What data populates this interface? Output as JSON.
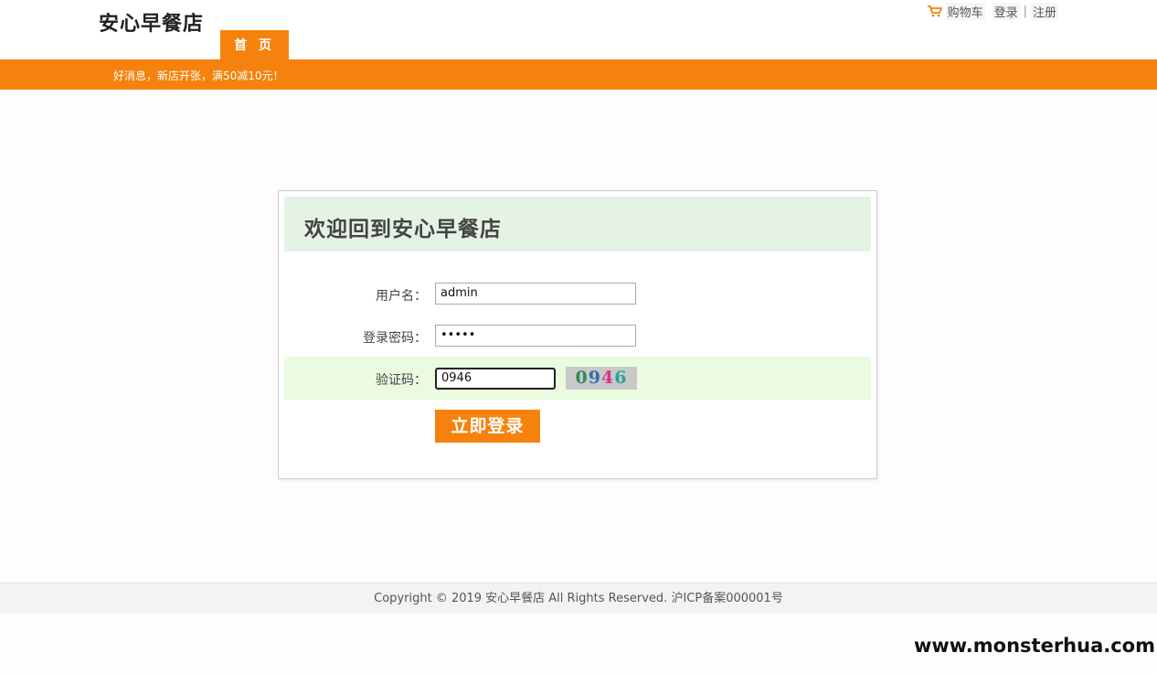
{
  "header": {
    "logo": "安心早餐店",
    "nav": {
      "home_label": "首 页"
    },
    "links": {
      "cart": "购物车",
      "login": "登录",
      "separator": "|",
      "register": "注册"
    }
  },
  "notice": {
    "text": "好消息，新店开张，满50减10元！"
  },
  "login": {
    "title": "欢迎回到安心早餐店",
    "username_label": "用户名：",
    "username_value": "admin",
    "password_label": "登录密码：",
    "password_value": "•••••",
    "captcha_label": "验证码：",
    "captcha_value": "0946",
    "captcha_image_digits": [
      "0",
      "9",
      "4",
      "6"
    ],
    "submit_label": "立即登录"
  },
  "footer": {
    "text": "Copyright © 2019 安心早餐店 All Rights Reserved. 沪ICP备案000001号"
  },
  "watermark": {
    "text": "www.monsterhua.com"
  },
  "colors": {
    "accent": "#f5820c",
    "title_bar": "#e4f3e4",
    "captcha_row": "#eafbe0",
    "captcha_digits": [
      "#2e8b57",
      "#2a6fb0",
      "#d6368a",
      "#2aa39b"
    ]
  }
}
